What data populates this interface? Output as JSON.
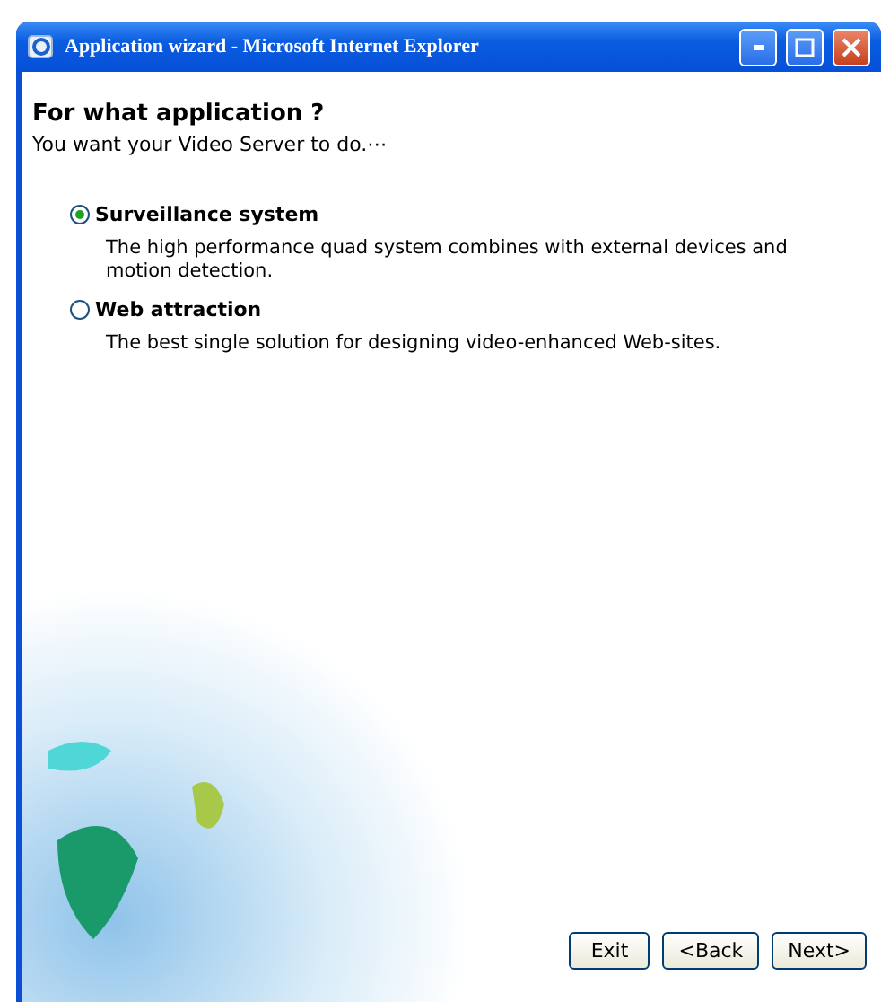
{
  "window": {
    "title": "Application wizard - Microsoft Internet Explorer"
  },
  "heading": "For what application ?",
  "subheading": "You want your Video Server to do.⋯",
  "options": [
    {
      "label": "Surveillance system",
      "description": "The high performance quad system combines with external devices and motion detection.",
      "selected": true
    },
    {
      "label": "Web attraction",
      "description": "The best single solution for designing video-enhanced Web-sites.",
      "selected": false
    }
  ],
  "buttons": [
    "Exit",
    "<Back",
    "Next>"
  ]
}
